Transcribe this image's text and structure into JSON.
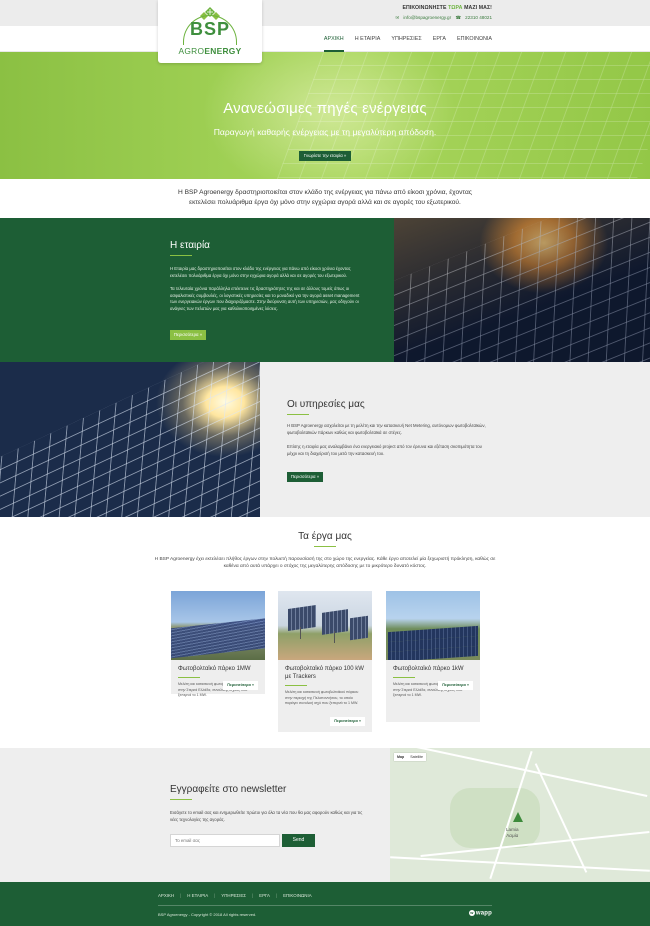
{
  "topbar": {
    "call_prefix": "ΕΠΙΚΟΙΝΩΝΗΣΤΕ ",
    "call_highlight": "ΤΩΡΑ",
    "call_suffix": " ΜΑΖΙ ΜΑΣ!",
    "email": "info@bspagroenergy.gr",
    "phone": "22310 48021"
  },
  "logo": {
    "main": "BSP",
    "sub_a": "AGRO",
    "sub_b": "ENERGY"
  },
  "nav": [
    {
      "label": "ΑΡΧΙΚΗ",
      "active": true
    },
    {
      "label": "Η ΕΤΑΙΡΙΑ",
      "active": false
    },
    {
      "label": "ΥΠΗΡΕΣΙΕΣ",
      "active": false
    },
    {
      "label": "ΕΡΓΑ",
      "active": false
    },
    {
      "label": "ΕΠΙΚΟΙΝΩΝΙΑ",
      "active": false
    }
  ],
  "hero": {
    "title": "Ανανεώσιμες πηγές ενέργειας",
    "subtitle": "Παραγωγή καθαρής ενέργειας με τη μεγαλύτερη απόδοση.",
    "button": "Γνωρίστε την εταιρία »"
  },
  "intro": {
    "text": "Η BSP Agroenergy δραστηριοποιείται στον κλάδο της ενέργειας για πάνω από είκοσι χρόνια, έχοντας εκτελέσει πολυάριθμα έργα όχι μόνο στην εγχώρια αγορά αλλά και σε αγορές του εξωτερικού."
  },
  "company": {
    "title": "Η εταιρία",
    "p1": "Η Εταιρία μας δραστηριοποιείται στον κλάδο της ενέργειας για πάνω από είκοσι χρόνια έχοντας εκτελέσει πολυάριθμα έργα όχι μόνο στην εγχώρια αγορά αλλά και σε αγορές του εξωτερικού.",
    "p2": "Τα τελευταία χρόνια παράλληλα επέκτεινε τις δραστηριότητες της και σε άλλους τομείς όπως οι ασφαλιστικές συμβουλές, οι λογιστικές υπηρεσίες και το μοναδικό για την αγορά asset management των ενεργειακών έργων που διαχειριζόμαστε. Στην διεύρυνση αυτή των υπηρεσιών, μας οδηγούν οι ανάγκες των πελατών μας για καθολικοποιημένες λύσεις.",
    "button": "Περισσότερα »"
  },
  "services": {
    "title": "Οι υπηρεσίες μας",
    "p1": "Η BSP Agroenergy ασχολείται με τη μελέτη και την κατασκευή Net Metering, αυτόνομων φωτοβολταϊκών, φωτοβολταϊκών πάρκων καθώς και φωτοβολταϊκά σε στέγες.",
    "p2": "Επίσης η εταιρία μας αναλαμβάνει ένα ενεργειακό project από τον έρευνα και εξέταση σκοπιμότητα του μέχρι και τη διαχείρισή του μετά την κατασκευή του.",
    "button": "Περισσότερα »"
  },
  "projects": {
    "title": "Τα έργα μας",
    "desc": "Η BSP Agroenergy έχει εκτελέσει πλήθος έργων στην πολυετή παρουσίασή της στο χώρο της ενεργείας. Κάθε έργο αποτελεί μία ξεχωριστή πρόκληση, καθώς σε καθένα από αυτά υπάρχει ο στόχος της μεγαλύτερης απόδοσης με το μικρότερο δυνατό κόστος.",
    "cards": [
      {
        "title": "Φωτοβολταϊκό πάρκο 1MW",
        "text": "Μελέτη και κατασκευή φωτοβολταϊκού πάρκου στην Στερεά Ελλάδα, συνολικής ισχύος που ξεπερνά το 1 MW.",
        "more": "Περισσότερα »"
      },
      {
        "title": "Φωτοβολταϊκό πάρκο 100 kW με Trackers",
        "text": "Μελέτη και κατασκευή φωτοβολταϊκού πάρκου στην περιοχή της Πελοποννήσου, το οποίο παράγει συνολική ισχύ που ξεπερνά το 1 MW.",
        "more": "Περισσότερα »"
      },
      {
        "title": "Φωτοβολταϊκό πάρκο 1kW",
        "text": "Μελέτη και κατασκευή φωτοβολταϊκού πάρκου στην Στερεά Ελλάδα, συνολικής ισχύος που ξεπερνά το 1 MW.",
        "more": "Περισσότερα »"
      }
    ]
  },
  "newsletter": {
    "title": "Εγγραφείτε στο newsletter",
    "text": "Εισάγετε το email σας και ενημερωθείτε πρώτοι για όλα τα νέα που θα μας αφορούν καθώς και για τις νέες τεχνολογίες της αγοράς.",
    "placeholder": "Το email σας",
    "button": "Send"
  },
  "map": {
    "tab_map": "Map",
    "tab_satellite": "Satellite",
    "city_main": "Lamia",
    "city_sub": "Λαμία"
  },
  "footer": {
    "nav": [
      "ΑΡΧΙΚΗ",
      "Η ΕΤΑΙΡΙΑ",
      "ΥΠΗΡΕΣΙΕΣ",
      "ΕΡΓΑ",
      "ΕΠΙΚΟΙΝΩΝΙΑ"
    ],
    "copyright": "BSP Agroenergy - Copyright © 2018 All rights reserved.",
    "brand": "wapp"
  },
  "colors": {
    "primary": "#1d5e35",
    "accent": "#8bc043",
    "light": "#eeeeee"
  }
}
